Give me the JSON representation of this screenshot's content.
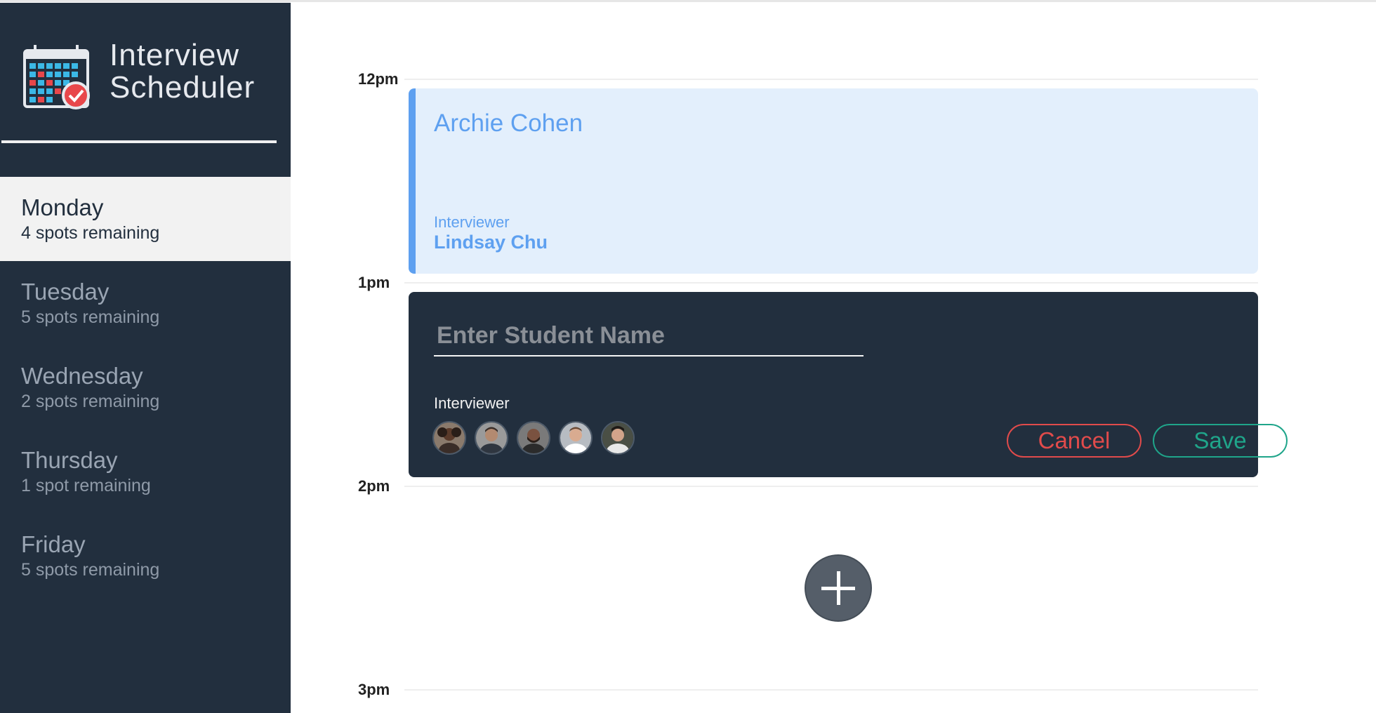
{
  "brand": {
    "line1": "Interview",
    "line2": "Scheduler",
    "logo_icon": "calendar-check-icon"
  },
  "days": [
    {
      "name": "Monday",
      "spots": "4 spots remaining",
      "selected": true
    },
    {
      "name": "Tuesday",
      "spots": "5 spots remaining",
      "selected": false
    },
    {
      "name": "Wednesday",
      "spots": "2 spots remaining",
      "selected": false
    },
    {
      "name": "Thursday",
      "spots": "1 spot remaining",
      "selected": false
    },
    {
      "name": "Friday",
      "spots": "5 spots remaining",
      "selected": false
    }
  ],
  "times": [
    "12pm",
    "1pm",
    "2pm",
    "3pm"
  ],
  "booked": {
    "student": "Archie Cohen",
    "interviewer_label": "Interviewer",
    "interviewer_name": "Lindsay Chu"
  },
  "form": {
    "placeholder": "Enter Student Name",
    "value": "",
    "interviewer_label": "Interviewer",
    "avatars": [
      "interviewer-avatar-1",
      "interviewer-avatar-2",
      "interviewer-avatar-3",
      "interviewer-avatar-4",
      "interviewer-avatar-5"
    ],
    "cancel_label": "Cancel",
    "save_label": "Save"
  },
  "add_icon": "plus-icon",
  "colors": {
    "sidebar": "#222f3e",
    "selected_day": "#f2f2f2",
    "booked_bg": "#e3effc",
    "booked_accent": "#5ea0f0",
    "cancel": "#e14b4b",
    "save": "#1fa58a",
    "add_button": "#555e69"
  }
}
